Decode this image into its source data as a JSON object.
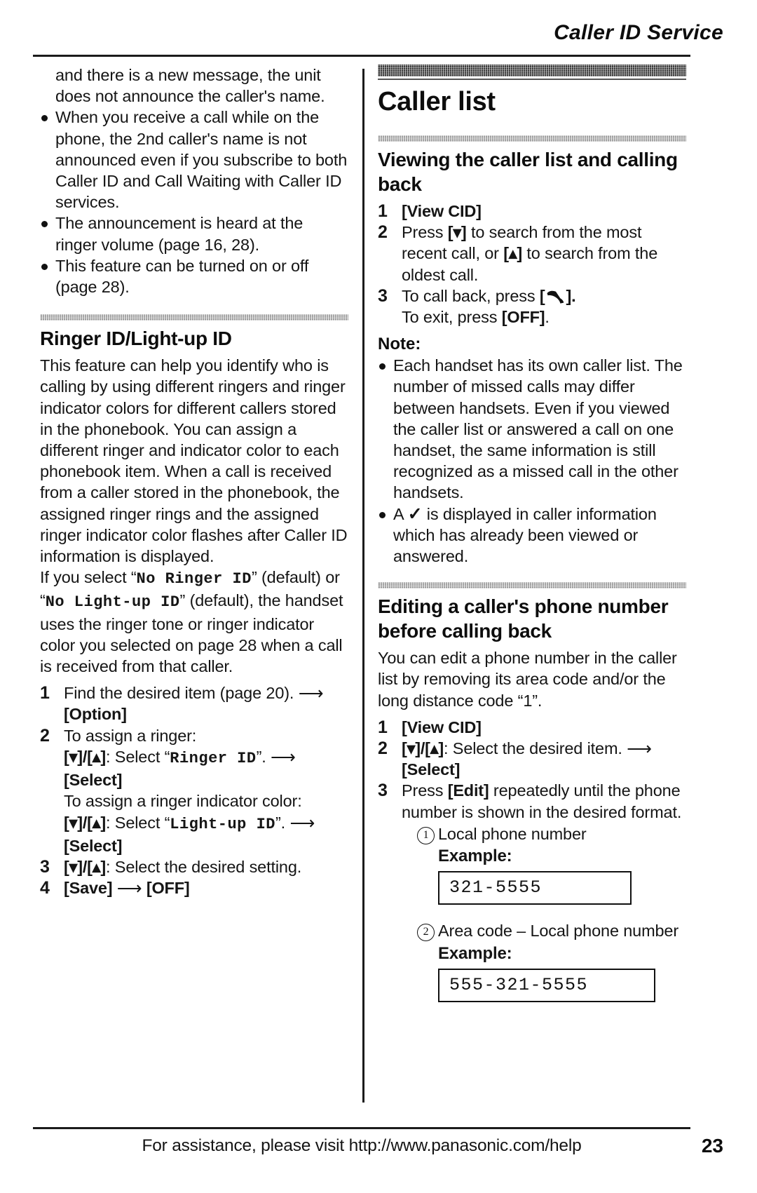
{
  "header": {
    "title": "Caller ID Service"
  },
  "left_column": {
    "continued_bullet": "and there is a new message, the unit does not announce the caller's name.",
    "bullets": [
      "When you receive a call while on the phone, the 2nd caller's name is not announced even if you subscribe to both Caller ID and Call Waiting with Caller ID services.",
      "The announcement is heard at the ringer volume (page 16, 28).",
      "This feature can be turned on or off (page 28)."
    ],
    "section": {
      "heading": "Ringer ID/Light-up ID",
      "body_part1": "This feature can help you identify who is calling by using different ringers and ringer indicator colors for different callers stored in the phonebook. You can assign a different ringer and indicator color to each phonebook item. When a call is received from a caller stored in the phonebook, the assigned ringer rings and the assigned ringer indicator color flashes after Caller ID information is displayed.",
      "body_part2_pre": "If you select “",
      "body_part2_mono1": "No Ringer ID",
      "body_part2_mid": "” (default) or “",
      "body_part2_mono2": "No Light-up ID",
      "body_part2_post": "” (default), the handset uses the ringer tone or ringer indicator color you selected on page 28 when a call is received from that caller.",
      "steps": [
        {
          "num": "1",
          "text_pre": "Find the desired item (page 20).",
          "arrow": "⟶",
          "key_after": "[Option]"
        },
        {
          "num": "2",
          "line1": "To assign a ringer:",
          "line2_keys": "[▾]/[▴]",
          "line2_text": ": Select “",
          "line2_mono": "Ringer ID",
          "line2_tail": "”.",
          "line2_arrow": "⟶",
          "line3_key": "[Select]",
          "line4": "To assign a ringer indicator color:",
          "line5_keys": "[▾]/[▴]",
          "line5_text": ": Select “",
          "line5_mono": "Light-up ID",
          "line5_tail": "”.",
          "line5_arrow": "⟶",
          "line6_key": "[Select]"
        },
        {
          "num": "3",
          "keys": "[▾]/[▴]",
          "text": ": Select the desired setting."
        },
        {
          "num": "4",
          "key1": "[Save]",
          "arrow": "⟶",
          "key2": "[OFF]"
        }
      ]
    }
  },
  "right_column": {
    "chapter_title": "Caller list",
    "section1": {
      "heading": "Viewing the caller list and calling back",
      "steps": [
        {
          "num": "1",
          "key": "[View CID]"
        },
        {
          "num": "2",
          "pre": "Press ",
          "key1": "[▾]",
          "mid": " to search from the most recent call, or ",
          "key2": "[▴]",
          "post": " to search from the oldest call."
        },
        {
          "num": "3",
          "line1_pre": "To call back, press ",
          "line1_key_open": "[",
          "line1_icon": "phone-handset-icon",
          "line1_key_close": "].",
          "line2_pre": "To exit, press ",
          "line2_key": "[OFF]",
          "line2_post": "."
        }
      ],
      "note_heading": "Note:",
      "notes": [
        {
          "text": "Each handset has its own caller list. The number of missed calls may differ between handsets. Even if you viewed the caller list or answered a call on one handset, the same information is still recognized as a missed call in the other handsets."
        },
        {
          "pre": "A ",
          "check": "✓",
          "post": " is displayed in caller information which has already been viewed or answered."
        }
      ]
    },
    "section2": {
      "heading": "Editing a caller's phone number before calling back",
      "intro": "You can edit a phone number in the caller list by removing its area code and/or the long distance code “1”.",
      "steps": [
        {
          "num": "1",
          "key": "[View CID]"
        },
        {
          "num": "2",
          "keys": "[▾]/[▴]",
          "text": ": Select the desired item.",
          "arrow": "⟶",
          "key_after": "[Select]"
        },
        {
          "num": "3",
          "pre": "Press ",
          "key": "[Edit]",
          "post": " repeatedly until the phone number is shown in the desired format."
        }
      ],
      "examples": [
        {
          "marker": "1",
          "label": "Local phone number",
          "example_label": "Example:",
          "value": "321-5555"
        },
        {
          "marker": "2",
          "label": "Area code – Local phone number",
          "example_label": "Example:",
          "value": "555-321-5555"
        }
      ]
    }
  },
  "footer": {
    "text": "For assistance, please visit http://www.panasonic.com/help",
    "page_number": "23"
  }
}
